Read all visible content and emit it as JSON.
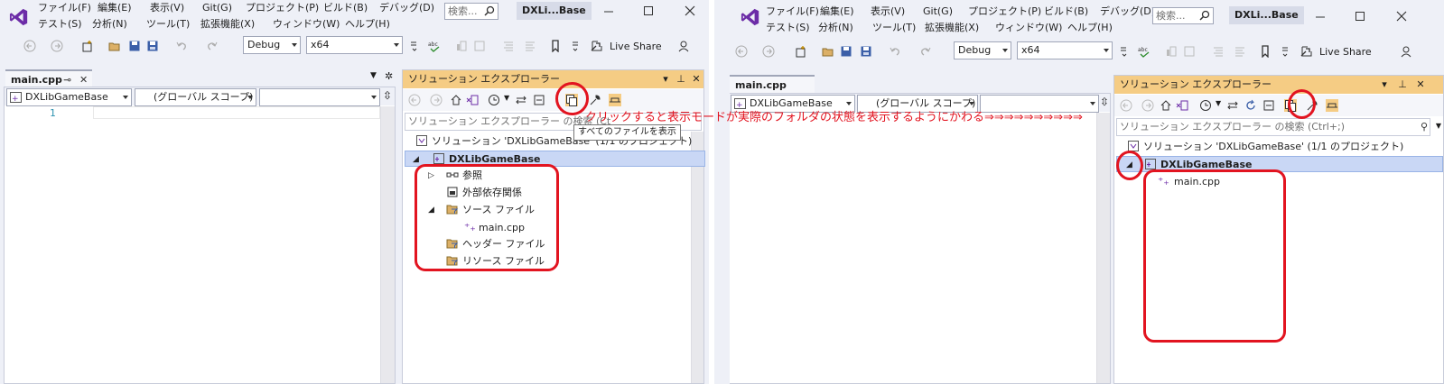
{
  "left": {
    "menu": [
      "ファイル(F)",
      "編集(E)",
      "表示(V)",
      "Git(G)",
      "プロジェクト(P)",
      "ビルド(B)",
      "デバッグ(D)",
      "テスト(S)",
      "分析(N)",
      "ツール(T)",
      "拡張機能(X)",
      "ウィンドウ(W)",
      "ヘルプ(H)"
    ],
    "search_placeholder": "検索...",
    "title": "DXLi...Base",
    "config": "Debug",
    "platform": "x64",
    "live_share": "Live Share",
    "doc_tab": "main.cpp",
    "scope_project": "DXLibGameBase",
    "scope_global": "(グローバル スコープ)",
    "scope_member": "",
    "line_number": "1",
    "panel_title": "ソリューション エクスプローラー",
    "panel_search": "ソリューション エクスプローラー の検索 (Ct",
    "tooltip": "すべてのファイルを表示",
    "tree": {
      "solution": "ソリューション 'DXLibGameBase' (1/1 のプロジェクト)",
      "project": "DXLibGameBase",
      "references": "参照",
      "external": "外部依存関係",
      "source_files": "ソース ファイル",
      "main_cpp": "main.cpp",
      "header_files": "ヘッダー ファイル",
      "resource_files": "リソース ファイル"
    }
  },
  "right": {
    "menu": [
      "ファイル(F)",
      "編集(E)",
      "表示(V)",
      "Git(G)",
      "プロジェクト(P)",
      "ビルド(B)",
      "デバッグ(D)",
      "テスト(S)",
      "分析(N)",
      "ツール(T)",
      "拡張機能(X)",
      "ウィンドウ(W)",
      "ヘルプ(H)"
    ],
    "search_placeholder": "検索...",
    "title": "DXLi...Base",
    "config": "Debug",
    "platform": "x64",
    "live_share": "Live Share",
    "doc_tab": "main.cpp",
    "scope_project": "DXLibGameBase",
    "scope_global": "(グローバル スコープ)",
    "scope_member": "",
    "panel_title": "ソリューション エクスプローラー",
    "panel_search": "ソリューション エクスプローラー の検索 (Ctrl+;)",
    "tree": {
      "solution": "ソリューション 'DXLibGameBase' (1/1 のプロジェクト)",
      "project": "DXLibGameBase",
      "main_cpp": "main.cpp"
    }
  },
  "annotation": "クリックすると表示モードが実際のフォルダの状態を表示するようにかわる⇒⇒⇒⇒⇒⇒⇒⇒⇒⇒",
  "colors": {
    "accent_red": "#e21420",
    "panel_header": "#f5cc84",
    "vs_purple": "#6c2ca7"
  }
}
